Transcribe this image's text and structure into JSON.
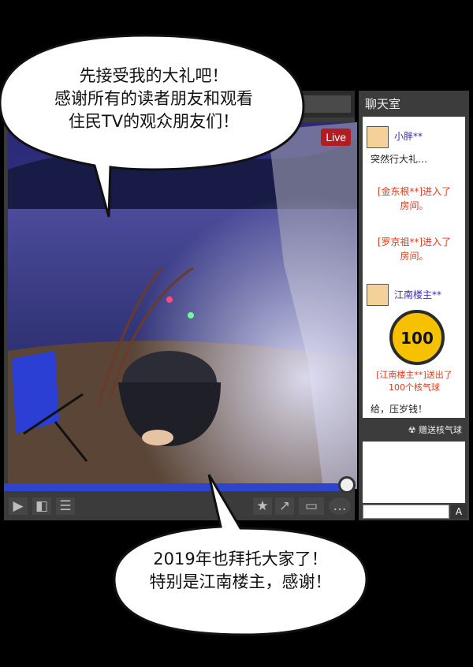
{
  "speech_top": {
    "line1": "先接受我的大礼吧！",
    "line2": "感谢所有的读者朋友和观看",
    "line3": "住民TV的观众朋友们！"
  },
  "speech_bottom": {
    "line1": "2019年也拜托大家了！",
    "line2": "特别是江南楼主，感谢！"
  },
  "player": {
    "live_label": "Live",
    "progress": 0.985
  },
  "chat": {
    "title": "聊天室",
    "messages": [
      {
        "user": "小胖**",
        "text": "突然行大礼…"
      },
      {
        "system1_a": "[金东根**]进入了",
        "system1_b": "房间。"
      },
      {
        "system2_a": "[罗京祖**]进入了",
        "system2_b": "房间。"
      },
      {
        "user": "江南楼主**"
      }
    ],
    "gift_amount": "100",
    "gift_notice_a": "[江南楼主**]送出了",
    "gift_notice_b": "100个核气球",
    "gift_message": "给，压岁钱！",
    "send_button": "赠送核气球",
    "input_button": "A"
  },
  "colors": {
    "live_bg": "#b41c24",
    "progress_fill": "#2d45c9",
    "system_text": "#e23a1a",
    "username": "#3b2bb0"
  }
}
